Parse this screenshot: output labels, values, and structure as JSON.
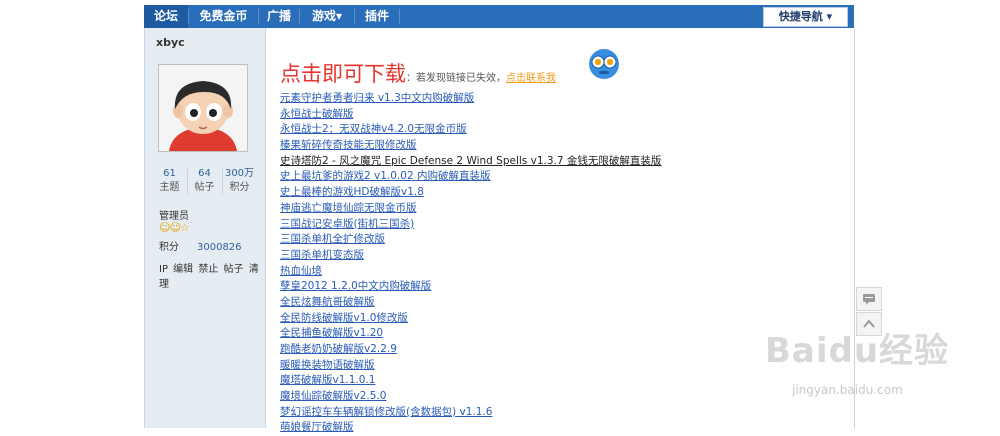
{
  "nav": {
    "items": [
      "论坛",
      "免费金币",
      "广播",
      "游戏▾",
      "插件"
    ],
    "quick_nav": "快捷导航 ▾"
  },
  "sidebar": {
    "username": "xbyc",
    "stats": [
      {
        "value": "61",
        "label": "主题"
      },
      {
        "value": "64",
        "label": "帖子"
      },
      {
        "value": "300万",
        "label": "积分"
      }
    ],
    "group": "管理员",
    "stars": "☺☺☆",
    "points_label": "积分",
    "points_value": "3000826",
    "actions": "IP 编辑 禁止 帖子 清理"
  },
  "main": {
    "headline": "点击即可下载",
    "note": "：若发现链接已失效，",
    "contact": "点击联系我",
    "links": [
      "元素守护者勇者归来 v1.3中文内购破解版",
      "永恒战士破解版",
      "永恒战士2：无双战神v4.2.0无限金币版",
      "榛果斩碎传奇技能无限修改版",
      "史诗塔防2 - 风之魔咒 Epic Defense 2 Wind Spells v1.3.7 金钱无限破解直装版",
      "史上最坑爹的游戏2 v1.0.02 内购破解直装版",
      "史上最棒的游戏HD破解版v1.8",
      "神庙逃亡魔境仙踪无限金币版",
      "三国战记安卓版(街机三国杀)",
      "三国杀单机全扩修改版",
      "三国杀单机变态版",
      "热血仙境",
      "孽皇2012 1.2.0中文内购破解版",
      "全民炫舞航哥破解版",
      "全民防线破解版v1.0修改版",
      "全民捕鱼破解版v1.20",
      "跑酷老奶奶破解版v2.2.9",
      "暖暖换装物语破解版",
      "魔塔破解版v1.1.0.1",
      "魔境仙踪破解版v2.5.0",
      "梦幻谣控车车辆解锁修改版(含数据包) v1.1.6",
      "萌娘餐厅破解版"
    ]
  },
  "watermark": {
    "brand": "Baidu经验",
    "url": "jingyan.baidu.com"
  },
  "colors": {
    "nav_bg": "#2a6db8",
    "link": "#2a5cb8",
    "headline": "#e6342e",
    "contact": "#f09a1a",
    "sidebar_bg": "#e5edf2"
  }
}
